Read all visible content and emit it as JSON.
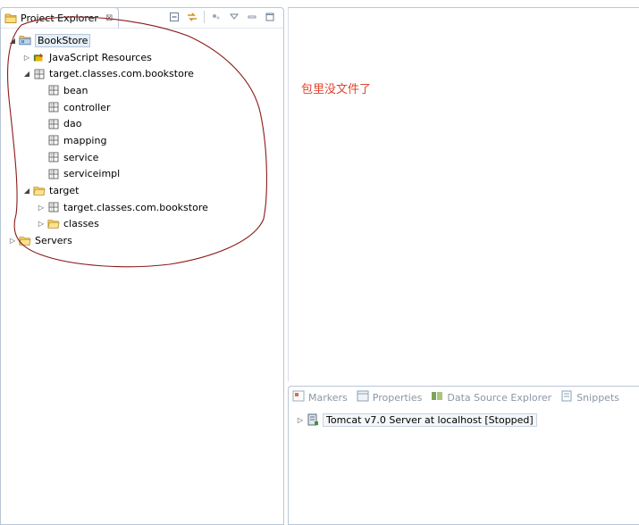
{
  "explorer": {
    "title": "Project Explorer",
    "close_glyph": "⊠",
    "tree": [
      {
        "label": "BookStore",
        "icon": "project-icon",
        "twisty": "expanded",
        "indent": 0,
        "selected": true
      },
      {
        "label": "JavaScript Resources",
        "icon": "js-resources-icon",
        "twisty": "collapsed",
        "indent": 1
      },
      {
        "label": "target.classes.com.bookstore",
        "icon": "package-icon",
        "twisty": "expanded",
        "indent": 1
      },
      {
        "label": "bean",
        "icon": "package-icon",
        "twisty": "none",
        "indent": 2
      },
      {
        "label": "controller",
        "icon": "package-icon",
        "twisty": "none",
        "indent": 2
      },
      {
        "label": "dao",
        "icon": "package-icon",
        "twisty": "none",
        "indent": 2
      },
      {
        "label": "mapping",
        "icon": "package-icon",
        "twisty": "none",
        "indent": 2
      },
      {
        "label": "service",
        "icon": "package-icon",
        "twisty": "none",
        "indent": 2
      },
      {
        "label": "serviceimpl",
        "icon": "package-icon",
        "twisty": "none",
        "indent": 2
      },
      {
        "label": "target",
        "icon": "folder-icon",
        "twisty": "expanded",
        "indent": 1
      },
      {
        "label": "target.classes.com.bookstore",
        "icon": "package-icon",
        "twisty": "collapsed",
        "indent": 2
      },
      {
        "label": "classes",
        "icon": "folder-icon",
        "twisty": "collapsed",
        "indent": 2
      },
      {
        "label": "Servers",
        "icon": "folder-icon",
        "twisty": "collapsed",
        "indent": 0
      }
    ]
  },
  "editor": {
    "annotation": "包里没文件了"
  },
  "bottom": {
    "tabs": [
      {
        "label": "Markers",
        "icon": "markers-icon"
      },
      {
        "label": "Properties",
        "icon": "properties-icon"
      },
      {
        "label": "Data Source Explorer",
        "icon": "data-source-icon"
      },
      {
        "label": "Snippets",
        "icon": "snippets-icon"
      }
    ],
    "server_entry": "Tomcat v7.0 Server at localhost  [Stopped]"
  },
  "colors": {
    "annotation": "#e0442c",
    "scribble": "#8b1a1a",
    "border": "#b9c6d6"
  }
}
